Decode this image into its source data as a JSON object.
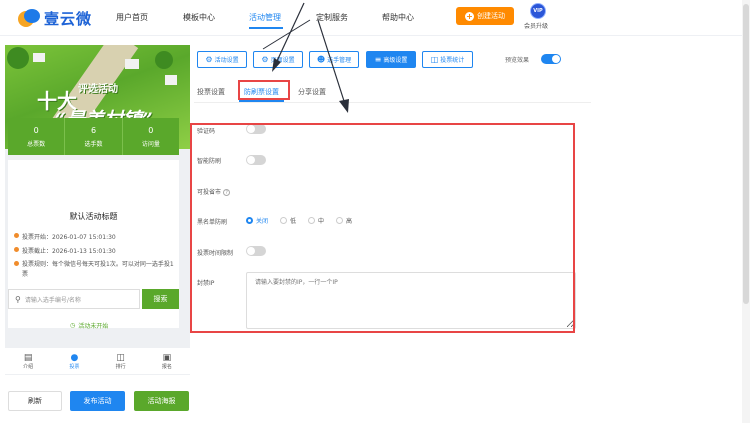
{
  "header": {
    "logo_text": "壹云微",
    "nav": [
      {
        "label": "用户首页"
      },
      {
        "label": "模板中心"
      },
      {
        "label": "活动管理"
      },
      {
        "label": "定制服务"
      },
      {
        "label": "帮助中心"
      }
    ],
    "active_nav": "活动管理",
    "create_button": "创建活动",
    "vip_badge": "VIP",
    "vip_label": "会员升级"
  },
  "preview": {
    "banner": {
      "big_chars": "十大",
      "sub_title": "评选活动",
      "main_title": "“最美村镇”"
    },
    "stats": [
      {
        "value": "0",
        "label": "总票数"
      },
      {
        "value": "6",
        "label": "选手数"
      },
      {
        "value": "0",
        "label": "访问量"
      }
    ],
    "activity_title": "默认活动标题",
    "info_lines": [
      "投票开始：2026-01-07 15:01:30",
      "投票截止：2026-01-13 15:01:30",
      "投票规则：每个微信号每天可投1次。可以对同一选手投1票"
    ],
    "search_placeholder": "请输入选手编号/名称",
    "search_button": "搜索",
    "status_text": "活动未开始",
    "bottom_tabs": [
      {
        "label": "介绍",
        "icon": "document-icon"
      },
      {
        "label": "投票",
        "icon": "person-icon"
      },
      {
        "label": "排行",
        "icon": "bar-chart-icon"
      },
      {
        "label": "报名",
        "icon": "upload-icon"
      }
    ],
    "active_bottom_tab": "投票"
  },
  "actions": {
    "refresh": "刷新",
    "publish": "发布活动",
    "poster": "活动海报"
  },
  "toolbar": {
    "buttons": [
      {
        "label": "活动设置",
        "icon": "gear-icon"
      },
      {
        "label": "页面设置",
        "icon": "gear-icon"
      },
      {
        "label": "选手管理",
        "icon": "users-icon"
      },
      {
        "label": "高级设置",
        "icon": "sliders-icon"
      },
      {
        "label": "投票统计",
        "icon": "bar-chart-icon"
      }
    ],
    "active_button": "高级设置",
    "preview_label": "预览效果",
    "preview_on": true
  },
  "subtabs": [
    {
      "label": "投票设置"
    },
    {
      "label": "防刷票设置"
    },
    {
      "label": "分享设置"
    }
  ],
  "active_subtab": "防刷票设置",
  "form": {
    "captcha_label": "验证码",
    "captcha_on": false,
    "smart_label": "智能防刷",
    "smart_on": false,
    "city_label": "可投省市",
    "blacklist_label": "黑名单防刷",
    "blacklist_options": [
      "关闭",
      "低",
      "中",
      "高"
    ],
    "blacklist_selected": "关闭",
    "time_limit_label": "投票时间限制",
    "time_limit_on": false,
    "ip_label": "封禁IP",
    "ip_placeholder": "请输入要封禁的IP，一行一个IP"
  },
  "colors": {
    "primary": "#1f86f0",
    "accent_orange": "#ff8a00",
    "preview_green": "#5aa82b",
    "annotation_red": "#e84545"
  }
}
